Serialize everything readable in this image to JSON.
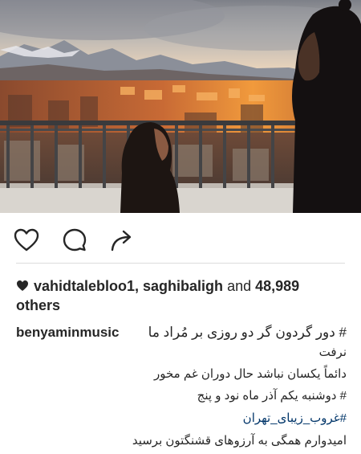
{
  "post": {
    "actions": {
      "like_icon": "heart-icon",
      "comment_icon": "comment-icon",
      "share_icon": "share-icon"
    },
    "likes": {
      "icon": "heart-filled-icon",
      "users": "vahidtalebloo1, saghibaligh",
      "connector": "and",
      "count": "48,989",
      "suffix": "others"
    },
    "caption": {
      "username": "benyaminmusic",
      "line1": "# دور گردون گر دو روزی بر مُراد ما",
      "line2": "نرفت",
      "line3": "دائماً یکسان نباشد حال دوران غم مخور",
      "line4": "# دوشنبه یکم آذر ماه نود و پنج",
      "hashtag": "#غروب_زیبای_تهران",
      "line6": "امیدوارم همگی به آرزوهای قشنگتون برسید"
    },
    "colors": {
      "text": "#262626",
      "hashtag": "#003569",
      "divider": "#dcdcdc"
    }
  }
}
